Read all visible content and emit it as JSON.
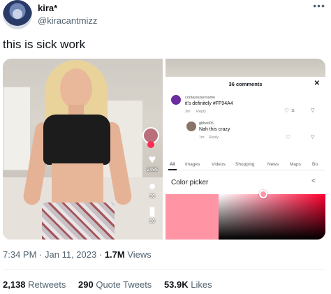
{
  "author": {
    "display_name": "kira*",
    "handle": "@kiracantmizz"
  },
  "tweet": {
    "text": "this is sick work",
    "time": "7:34 PM",
    "separator": "·",
    "date": "Jan 11, 2023",
    "views_count": "1.7M",
    "views_label": "Views"
  },
  "stats": {
    "retweets_count": "2,138",
    "retweets_label": "Retweets",
    "quotes_count": "290",
    "quotes_label": "Quote Tweets",
    "likes_count": "53.9K",
    "likes_label": "Likes"
  },
  "video": {
    "likes": "2495",
    "comments": "36",
    "saves": "80"
  },
  "comments_sheet": {
    "title": "36 comments",
    "items": [
      {
        "user": "coolassusername",
        "text": "it's definitely #FF94A4",
        "time": "3m",
        "reply": "Reply",
        "likes": "11"
      },
      {
        "user": "gbbell05",
        "text": "Nah this crazy",
        "time": "1m",
        "reply": "Reply",
        "likes": ""
      }
    ]
  },
  "google": {
    "tabs": [
      "All",
      "Images",
      "Videos",
      "Shopping",
      "News",
      "Maps",
      "Bo"
    ],
    "card_title": "Color picker",
    "selected_color": "#FF94A4"
  },
  "colors": {
    "picked": "#FF94A4",
    "tiktok_red": "#fe2c55",
    "text_secondary": "#536471"
  }
}
